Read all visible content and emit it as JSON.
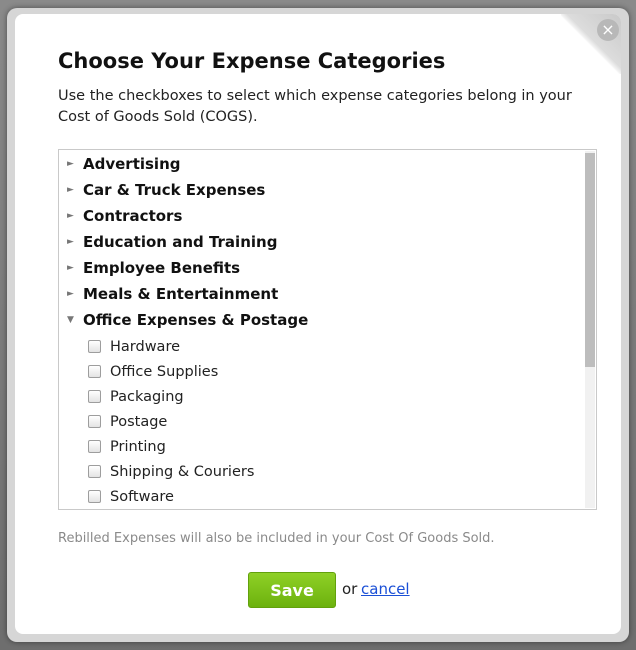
{
  "dialog": {
    "title": "Choose Your Expense Categories",
    "intro": "Use the checkboxes to select which expense categories belong in your Cost of Goods Sold (COGS).",
    "close_glyph": "×",
    "categories": [
      {
        "label": "Advertising",
        "arrow": "►",
        "expanded": false
      },
      {
        "label": "Car & Truck Expenses",
        "arrow": "►",
        "expanded": false
      },
      {
        "label": "Contractors",
        "arrow": "►",
        "expanded": false
      },
      {
        "label": "Education and Training",
        "arrow": "►",
        "expanded": false
      },
      {
        "label": "Employee Benefits",
        "arrow": "►",
        "expanded": false
      },
      {
        "label": "Meals & Entertainment",
        "arrow": "►",
        "expanded": false
      },
      {
        "label": "Office Expenses & Postage",
        "arrow": "▼",
        "expanded": true
      }
    ],
    "office_items": [
      {
        "label": "Hardware",
        "checked": false
      },
      {
        "label": "Office Supplies",
        "checked": false
      },
      {
        "label": "Packaging",
        "checked": false
      },
      {
        "label": "Postage",
        "checked": false
      },
      {
        "label": "Printing",
        "checked": false
      },
      {
        "label": "Shipping & Couriers",
        "checked": false
      },
      {
        "label": "Software",
        "checked": false
      }
    ],
    "footnote": "Rebilled Expenses will also be included in your Cost Of Goods Sold.",
    "save_label": "Save",
    "or_text": "or",
    "cancel_label": "cancel"
  },
  "colors": {
    "save_button": "#7cc11a",
    "link": "#1a4fd6",
    "footnote": "#8a8a8a"
  }
}
